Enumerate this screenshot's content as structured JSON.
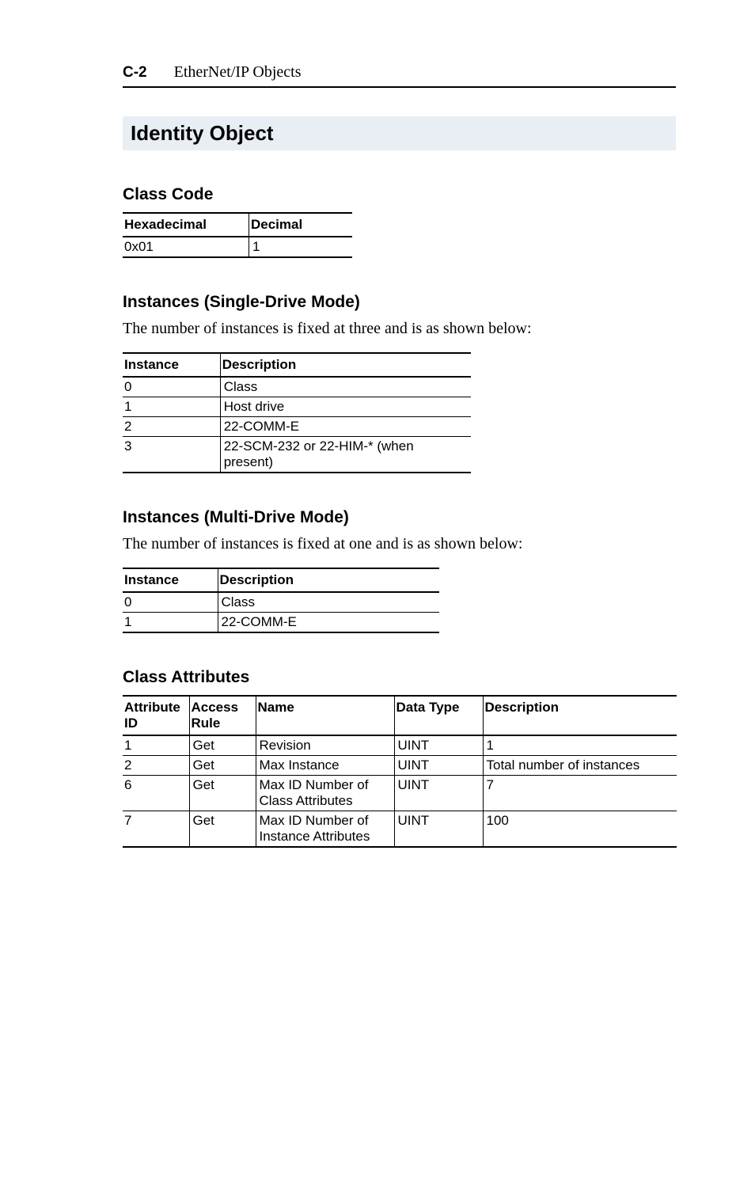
{
  "header": {
    "page_number": "C-2",
    "title": "EtherNet/IP Objects"
  },
  "section_title": "Identity Object",
  "class_code": {
    "heading": "Class Code",
    "headers": [
      "Hexadecimal",
      "Decimal"
    ],
    "rows": [
      [
        "0x01",
        "1"
      ]
    ]
  },
  "instances_single": {
    "heading": "Instances (Single-Drive Mode)",
    "intro": "The number of instances is fixed at three and is as shown below:",
    "headers": [
      "Instance",
      "Description"
    ],
    "rows": [
      [
        "0",
        "Class"
      ],
      [
        "1",
        "Host drive"
      ],
      [
        "2",
        "22-COMM-E"
      ],
      [
        "3",
        "22-SCM-232 or 22-HIM-* (when present)"
      ]
    ]
  },
  "instances_multi": {
    "heading": "Instances (Multi-Drive Mode)",
    "intro": "The number of instances is fixed at one and is as shown below:",
    "headers": [
      "Instance",
      "Description"
    ],
    "rows": [
      [
        "0",
        "Class"
      ],
      [
        "1",
        "22-COMM-E"
      ]
    ]
  },
  "class_attributes": {
    "heading": "Class Attributes",
    "headers": [
      "Attribute ID",
      "Access Rule",
      "Name",
      "Data Type",
      "Description"
    ],
    "rows": [
      [
        "1",
        "Get",
        "Revision",
        "UINT",
        "1"
      ],
      [
        "2",
        "Get",
        "Max Instance",
        "UINT",
        "Total number of instances"
      ],
      [
        "6",
        "Get",
        "Max ID Number of Class Attributes",
        "UINT",
        "7"
      ],
      [
        "7",
        "Get",
        "Max ID Number of Instance Attributes",
        "UINT",
        "100"
      ]
    ]
  }
}
